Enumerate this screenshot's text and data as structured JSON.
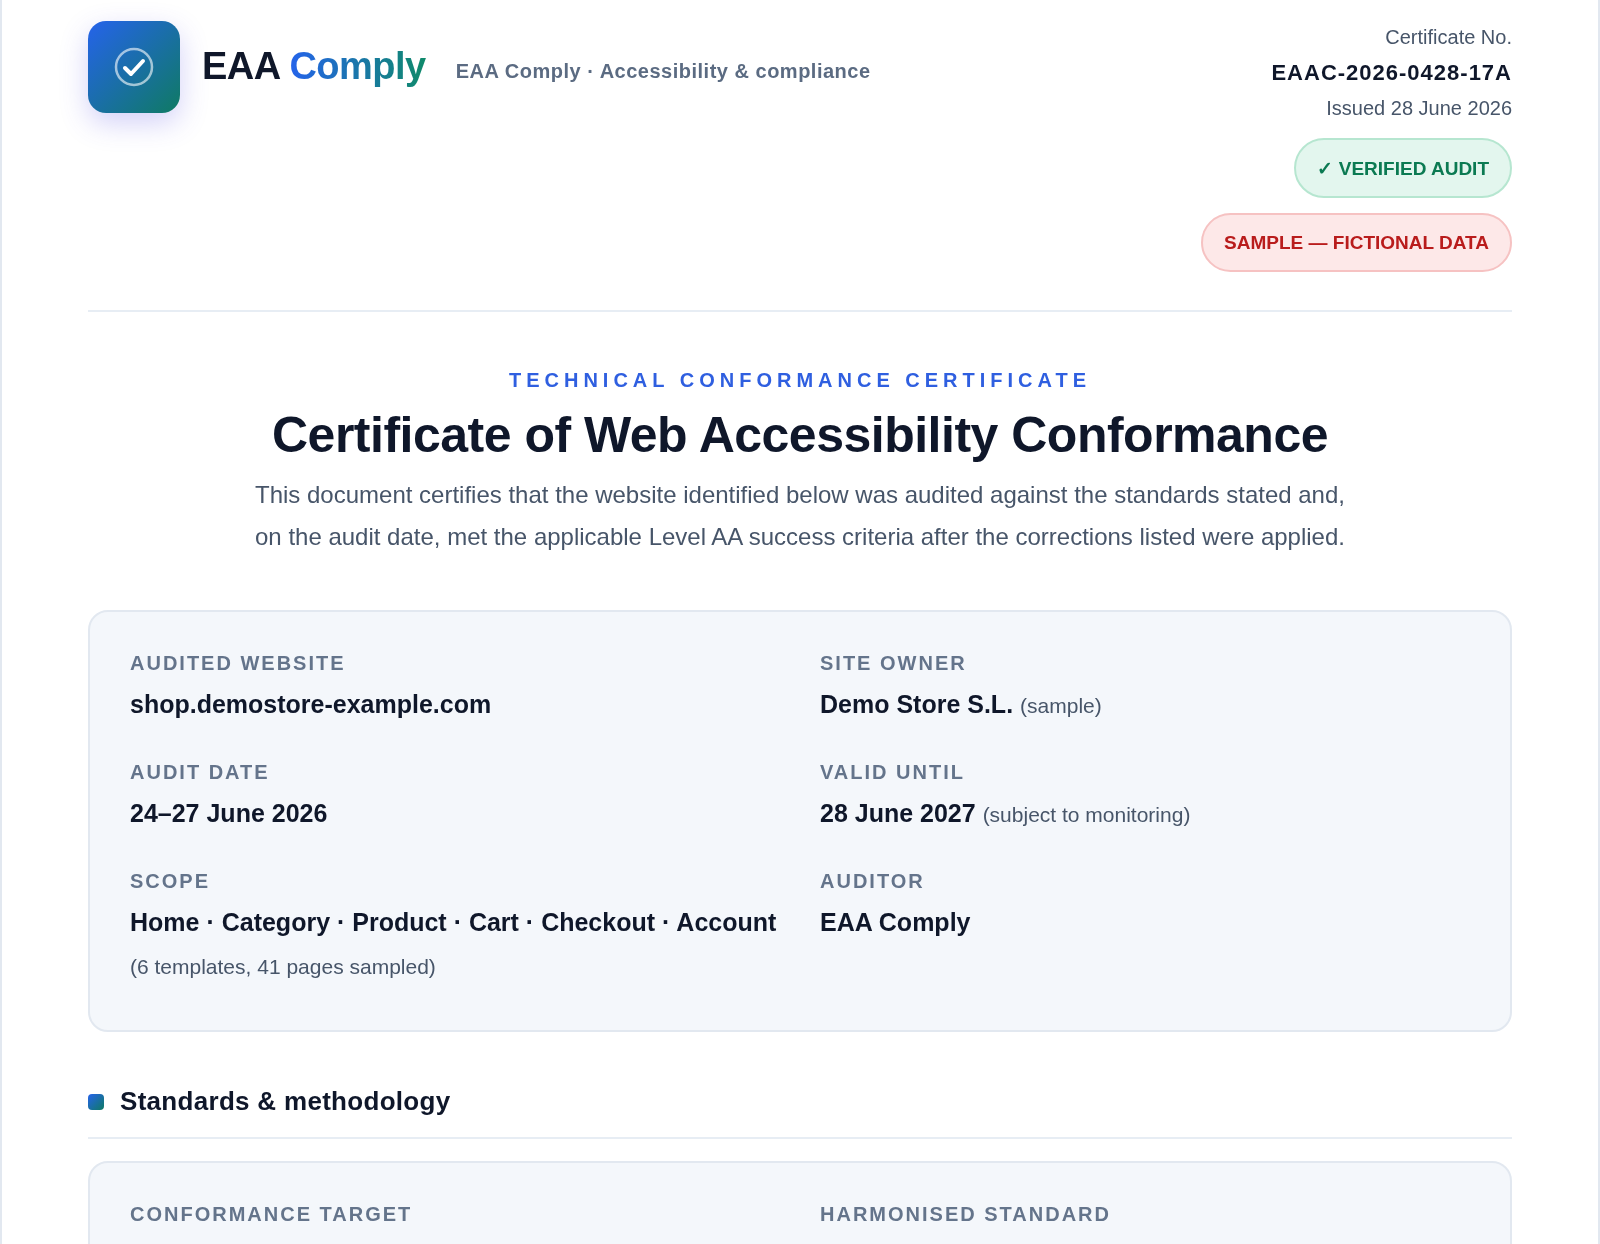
{
  "brand": {
    "name_primary": "EAA",
    "name_accent": "Comply",
    "tagline": "EAA Comply · Accessibility & compliance"
  },
  "certificate": {
    "number_label": "Certificate No.",
    "number": "EAAC-2026-0428-17A",
    "issued": "Issued 28 June 2026",
    "badges": [
      {
        "kind": "verified",
        "text": "✓ VERIFIED AUDIT"
      },
      {
        "kind": "sample",
        "text": "SAMPLE — FICTIONAL DATA"
      }
    ]
  },
  "intro": {
    "eyebrow": "TECHNICAL CONFORMANCE CERTIFICATE",
    "title": "Certificate of Web Accessibility Conformance",
    "text": "This document certifies that the website identified below was audited against the standards stated and, on the audit date, met the applicable Level AA success criteria after the corrections listed were applied."
  },
  "details": [
    {
      "label": "AUDITED WEBSITE",
      "value": "shop.demostore-example.com"
    },
    {
      "label": "SITE OWNER",
      "value": "Demo Store S.L.",
      "note": "(sample)"
    },
    {
      "label": "AUDIT DATE",
      "value": "24–27 June 2026"
    },
    {
      "label": "VALID UNTIL",
      "value": "28 June 2027",
      "note": "(subject to monitoring)"
    },
    {
      "label": "SCOPE",
      "value": "Home · Category · Product · Cart · Checkout · Account",
      "note": "(6 templates, 41 pages sampled)"
    },
    {
      "label": "AUDITOR",
      "value": "EAA Comply"
    }
  ],
  "sections": [
    {
      "title": "Standards & methodology",
      "details": [
        {
          "label": "CONFORMANCE TARGET"
        },
        {
          "label": "HARMONISED STANDARD"
        }
      ]
    }
  ]
}
